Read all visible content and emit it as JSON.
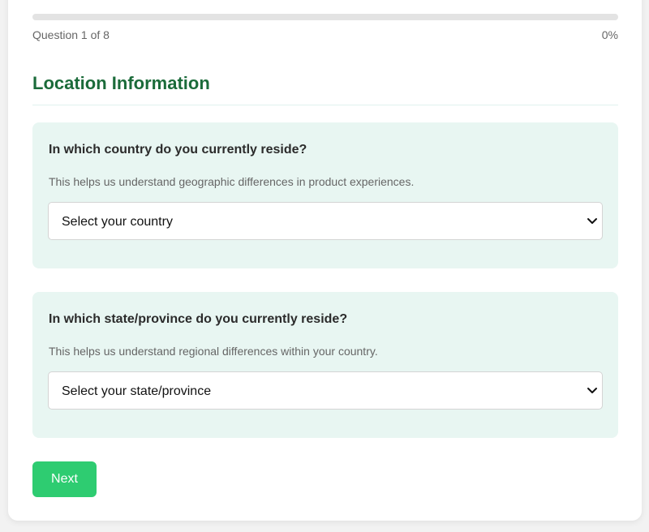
{
  "progress": {
    "question_text": "Question 1 of 8",
    "percent_text": "0%",
    "percent_value": 0
  },
  "section": {
    "title": "Location Information"
  },
  "questions": [
    {
      "label": "In which country do you currently reside?",
      "help": "This helps us understand geographic differences in product experiences.",
      "select_value": "Select your country"
    },
    {
      "label": "In which state/province do you currently reside?",
      "help": "This helps us understand regional differences within your country.",
      "select_value": "Select your state/province"
    }
  ],
  "actions": {
    "next_label": "Next"
  },
  "colors": {
    "accent": "#2ecc71",
    "title": "#1b6b3a",
    "question_bg": "#e8f6f2"
  },
  "icons": {
    "select_chevron": "chevron-down-icon"
  }
}
